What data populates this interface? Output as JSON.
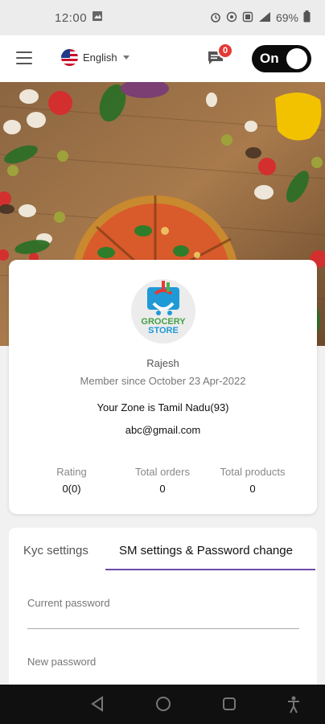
{
  "status_bar": {
    "time": "12:00",
    "battery": "69%"
  },
  "header": {
    "language": "English",
    "notification_count": "0",
    "toggle_label": "On"
  },
  "profile": {
    "logo_line1": "GROCERY",
    "logo_line2": "STORE",
    "name": "Rajesh",
    "member_since": "Member since October 23 Apr-2022",
    "zone": "Your Zone is Tamil Nadu(93)",
    "email": "abc@gmail.com",
    "stats": [
      {
        "label": "Rating",
        "value": "0(0)"
      },
      {
        "label": "Total orders",
        "value": "0"
      },
      {
        "label": "Total products",
        "value": "0"
      }
    ]
  },
  "settings": {
    "tabs": [
      {
        "label": "Kyc settings"
      },
      {
        "label": "SM settings & Password change"
      }
    ],
    "active_tab": 1,
    "accent_color": "#6e4aa8",
    "fields": [
      {
        "label": "Current password",
        "value": ""
      },
      {
        "label": "New password",
        "value": ""
      }
    ]
  },
  "colors": {
    "badge": "#e53935",
    "toggle_bg": "#0b0b0b"
  }
}
